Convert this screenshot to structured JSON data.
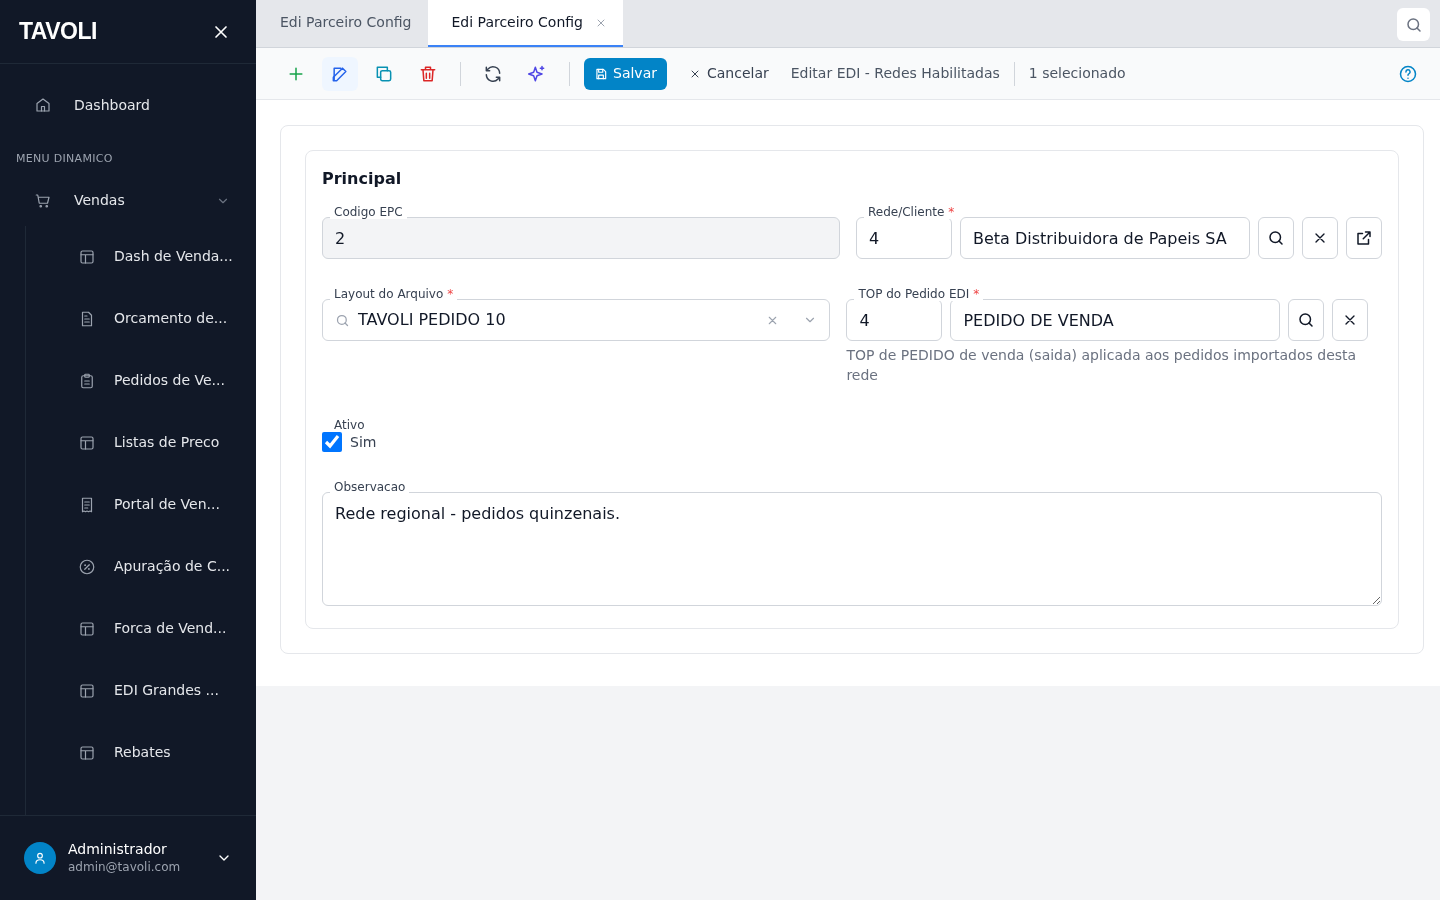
{
  "app": {
    "logo": "TAVOLI"
  },
  "sidebar": {
    "items": [
      {
        "label": "Dashboard",
        "kind": "home"
      }
    ],
    "section": "MENU DINAMICO",
    "groups": [
      {
        "label": "Vendas",
        "kind": "cart",
        "expanded": true,
        "children": [
          {
            "label": "Dash de Venda...",
            "kind": "layout"
          },
          {
            "label": "Orcamento de...",
            "kind": "document"
          },
          {
            "label": "Pedidos de Ve...",
            "kind": "clipboard"
          },
          {
            "label": "Listas de Preco",
            "kind": "layout"
          },
          {
            "label": "Portal de Ven...",
            "kind": "receipt"
          },
          {
            "label": "Apuração de C...",
            "kind": "percent"
          },
          {
            "label": "Forca de Vend...",
            "kind": "layout"
          },
          {
            "label": "EDI Grandes ...",
            "kind": "layout"
          },
          {
            "label": "Rebates",
            "kind": "layout"
          }
        ]
      }
    ]
  },
  "user": {
    "name": "Administrador",
    "email": "admin@tavoli.com"
  },
  "tabs": [
    {
      "label": "Edi Parceiro Config",
      "selected": false
    },
    {
      "label": "Edi Parceiro Config",
      "selected": true
    }
  ],
  "toolbar": {
    "save": "Salvar",
    "cancel": "Cancelar",
    "title": "Editar EDI - Redes Habilitadas",
    "selection": "1 selecionado"
  },
  "form": {
    "section": "Principal",
    "codigo": {
      "label": "Codigo EPC",
      "value": "2",
      "disabled": true
    },
    "rede": {
      "label": "Rede/Cliente",
      "required_mark": "*",
      "code": "4",
      "name": "Beta Distribuidora de Papeis SA"
    },
    "layout": {
      "label": "Layout do Arquivo",
      "required_mark": "*",
      "value": "TAVOLI PEDIDO 10"
    },
    "top": {
      "label": "TOP do Pedido EDI",
      "required_mark": "*",
      "code": "4",
      "name": "PEDIDO DE VENDA",
      "help": "TOP de PEDIDO de venda (saida) aplicada aos pedidos importados desta rede"
    },
    "ativo": {
      "label": "Ativo",
      "option": "Sim",
      "checked": true
    },
    "obs": {
      "label": "Observacao",
      "value": "Rede regional - pedidos quinzenais."
    }
  }
}
